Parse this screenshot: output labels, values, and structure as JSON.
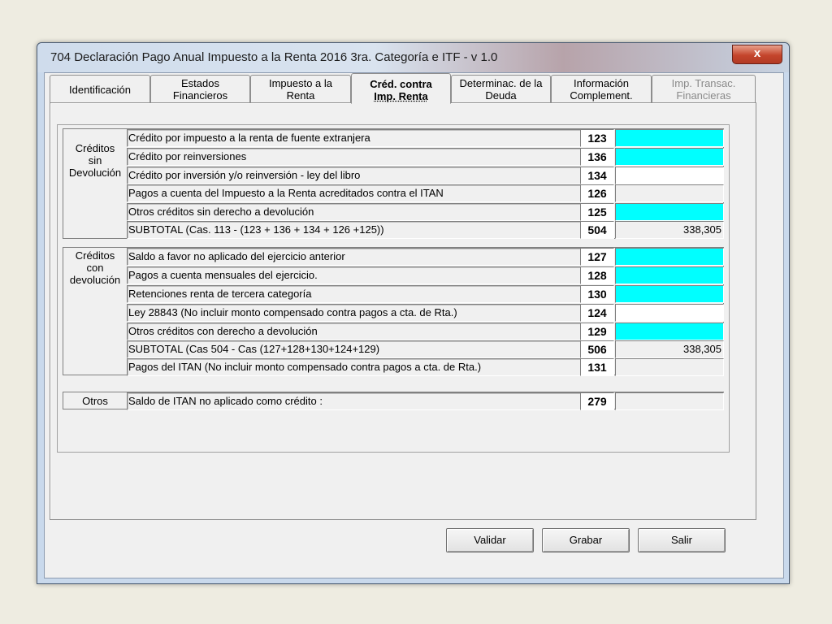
{
  "window": {
    "title": "704 Declaración Pago Anual Impuesto a la Renta 2016 3ra. Categoría e ITF - v 1.0",
    "close_glyph": "x"
  },
  "tabs": [
    {
      "line1": "Identificación",
      "line2": ""
    },
    {
      "line1": "Estados",
      "line2": "Financieros"
    },
    {
      "line1": "Impuesto a  la",
      "line2": "Renta"
    },
    {
      "line1": "Créd. contra",
      "line2": "Imp. Renta"
    },
    {
      "line1": "Determinac. de la",
      "line2": "Deuda"
    },
    {
      "line1": "Información",
      "line2": "Complement."
    },
    {
      "line1": "Imp. Transac.",
      "line2": "Financieras"
    }
  ],
  "groups": {
    "sin_devolucion": {
      "label": [
        "Créditos",
        "sin",
        "Devolución"
      ],
      "rows": [
        {
          "desc": "Crédito por impuesto a la renta de fuente extranjera",
          "code": "123",
          "value": ""
        },
        {
          "desc": "Crédito por reinversiones",
          "code": "136",
          "value": ""
        },
        {
          "desc": "Crédito por inversión y/o reinversión - ley del libro",
          "code": "134",
          "value": ""
        },
        {
          "desc": "Pagos a cuenta del Impuesto a la Renta acreditados contra el ITAN",
          "code": "126",
          "value": ""
        },
        {
          "desc": "Otros créditos sin derecho a devolución",
          "code": "125",
          "value": ""
        },
        {
          "desc": "SUBTOTAL (Cas. 113 -  (123 + 136 + 134 + 126 +125))",
          "code": "504",
          "value": "338,305"
        }
      ]
    },
    "con_devolucion": {
      "label": [
        "Créditos",
        "con",
        "devolución"
      ],
      "rows": [
        {
          "desc": "Saldo a favor no aplicado del ejercicio anterior",
          "code": "127",
          "value": ""
        },
        {
          "desc": "Pagos a cuenta mensuales del ejercicio.",
          "code": "128",
          "value": ""
        },
        {
          "desc": "Retenciones  renta de tercera categoría",
          "code": "130",
          "value": ""
        },
        {
          "desc": "Ley 28843 (No incluir monto compensado contra pagos a cta. de Rta.)",
          "code": "124",
          "value": ""
        },
        {
          "desc": "Otros créditos con derecho a devolución",
          "code": "129",
          "value": ""
        },
        {
          "desc": "SUBTOTAL (Cas 504 - Cas (127+128+130+124+129)",
          "code": "506",
          "value": "338,305"
        },
        {
          "desc": "Pagos del ITAN (No incluir monto compensado contra pagos a cta. de Rta.)",
          "code": "131",
          "value": ""
        }
      ]
    },
    "otros": {
      "label": [
        "Otros"
      ],
      "rows": [
        {
          "desc": "Saldo de ITAN no aplicado como crédito :",
          "code": "279",
          "value": ""
        }
      ]
    }
  },
  "buttons": {
    "validar": "Validar",
    "grabar": "Grabar",
    "salir": "Salir"
  },
  "colors": {
    "editable_field": "#00ffff",
    "window_frame": "#c9d9ec",
    "close_button": "#c4452c"
  }
}
